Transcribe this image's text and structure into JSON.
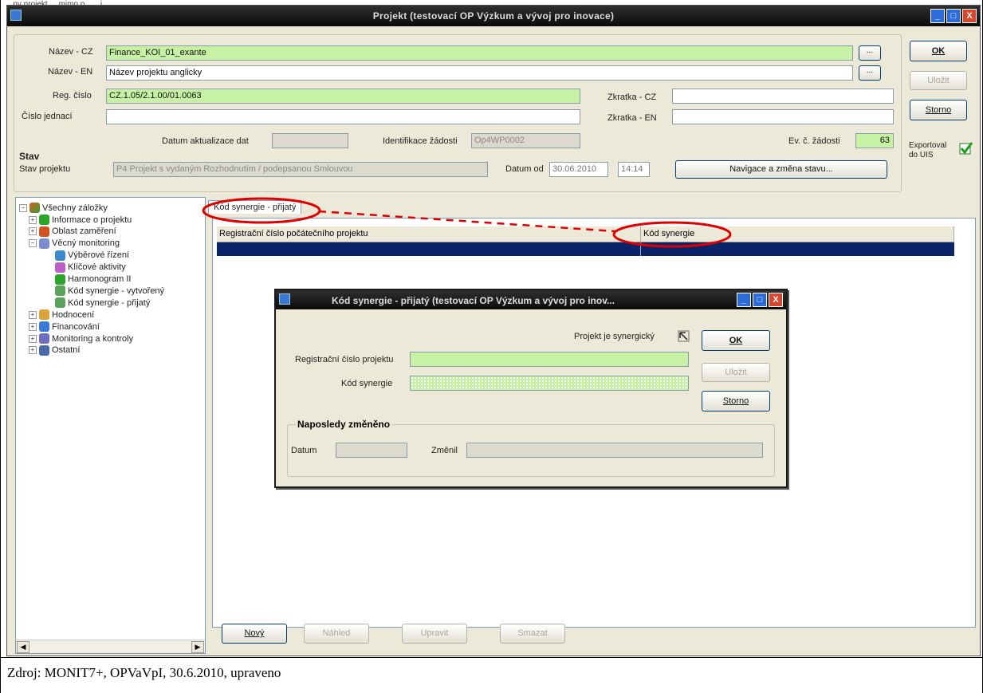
{
  "top_text": "...ny projekt ... mimo p... ...j",
  "window": {
    "title": "Projekt  (testovací OP Výzkum a vývoj pro inovace)",
    "controls": [
      "_",
      "□",
      "X"
    ]
  },
  "form": {
    "nazev_cz_label": "Název - CZ",
    "nazev_cz_value": "Finance_KOI_01_exante",
    "nazev_en_label": "Název - EN",
    "nazev_en_value": "Název projektu anglicky",
    "reg_label": "Reg. číslo",
    "reg_value": "CZ.1.05/2.1.00/01.0063",
    "cislo_label": "Číslo jednací",
    "cislo_value": "",
    "zkratka_cz_label": "Zkratka - CZ",
    "zkratka_cz_value": "",
    "zkratka_en_label": "Zkratka - EN",
    "zkratka_en_value": "",
    "datum_akt_label": "Datum aktualizace dat",
    "datum_akt_value": "",
    "ident_label": "Identifikace žádosti",
    "ident_value": "Op4WP0002",
    "ev_label": "Ev. č. žádosti",
    "ev_value": "63",
    "stav_group": "Stav",
    "stav_label": "Stav projektu",
    "stav_value": "P4 Projekt s vydaným Rozhodnutím / podepsanou Smlouvou",
    "datum_od_label": "Datum od",
    "datum_od_value": "30.06.2010",
    "cas_value": "14:14",
    "navigace_btn": "Navigace a změna stavu...",
    "ellipsis": "..."
  },
  "side_buttons": {
    "ok": "OK",
    "ulozit": "Uložit",
    "storno": "Storno",
    "exportoval": "Exportoval do UIS"
  },
  "tree": {
    "root": "Všechny záložky",
    "items": [
      {
        "label": "Informace o projektu",
        "level": 1,
        "pm": "+",
        "color": "#2aa52a"
      },
      {
        "label": "Oblast zaměření",
        "level": 1,
        "pm": "+",
        "color": "#d4501e"
      },
      {
        "label": "Věcný monitoring",
        "level": 1,
        "pm": "-",
        "color": "#7b8ccf"
      },
      {
        "label": "Výběrové řízení",
        "level": 2,
        "pm": "",
        "color": "#3a8ad0"
      },
      {
        "label": "Klíčové aktivity",
        "level": 2,
        "pm": "",
        "color": "#c05ec8"
      },
      {
        "label": "Harmonogram II",
        "level": 2,
        "pm": "",
        "color": "#2aa52a"
      },
      {
        "label": "Kód synergie - vytvořený",
        "level": 2,
        "pm": "",
        "color": "#5aa35a"
      },
      {
        "label": "Kód synergie - přijatý",
        "level": 2,
        "pm": "",
        "color": "#5aa35a"
      },
      {
        "label": "Hodnocení",
        "level": 1,
        "pm": "+",
        "color": "#d9a43a"
      },
      {
        "label": "Financování",
        "level": 1,
        "pm": "+",
        "color": "#3a7ad8"
      },
      {
        "label": "Monitoring a kontroly",
        "level": 1,
        "pm": "+",
        "color": "#6c6cc0"
      },
      {
        "label": "Ostatní",
        "level": 1,
        "pm": "+",
        "color": "#4a6aa8"
      }
    ]
  },
  "panel": {
    "tab": "Kód synergie - přijatý",
    "col1": "Registrační číslo počátečního projektu",
    "col2": "Kód synergie"
  },
  "bottom_buttons": {
    "novy": "Nový",
    "nahled": "Náhled",
    "upravit": "Upravit",
    "smazat": "Smazat"
  },
  "dialog": {
    "title": "Kód synergie - přijatý  (testovací OP Výzkum a vývoj pro inov...",
    "synergicky_label": "Projekt je synergický",
    "reg_label": "Registrační číslo projektu",
    "kod_label": "Kód synergie",
    "ok": "OK",
    "ulozit": "Uložit",
    "storno": "Storno",
    "group": "Naposledy změněno",
    "datum_label": "Datum",
    "zmenil_label": "Změnil"
  },
  "caption": "Zdroj: MONIT7+, OPVaVpI, 30.6.2010, upraveno",
  "colors": {
    "highlight_red": "#e00000",
    "selection_blue": "#0a246a",
    "required_green": "#c7f1a4"
  }
}
